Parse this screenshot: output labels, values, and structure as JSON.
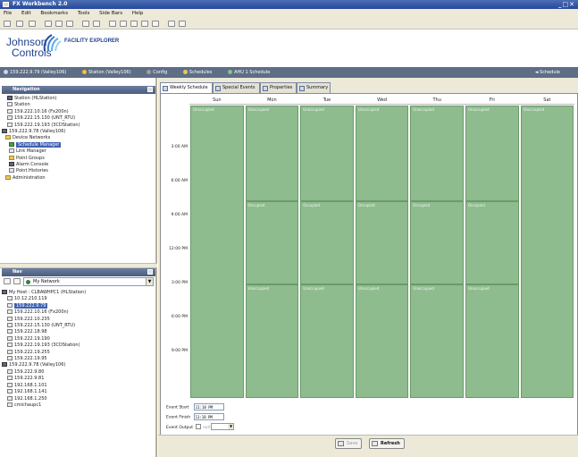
{
  "window": {
    "title": "FX Workbench 2.0"
  },
  "menu": [
    "File",
    "Edit",
    "Bookmarks",
    "Tools",
    "Side Bars",
    "Help"
  ],
  "brand": {
    "company": "Johnson Controls",
    "company_line1": "Johnson",
    "company_line2": "Controls",
    "product": "FACILITY EXPLORER"
  },
  "breadcrumb": {
    "items": [
      "159.222.9.79 (Valley106)",
      "Station (Valley106)",
      "Config",
      "Schedules",
      "AHU 1 Schedule"
    ],
    "right": "Schedule"
  },
  "nav": {
    "title": "Navigation",
    "items": [
      "Station (HLStation)",
      "Station",
      "159.222.10.16 (Fx200n)",
      "159.222.15.130 (UNT_RTU)",
      "159.222.19.193 (3CDStation)",
      "159.222.9.78 (Valley106)",
      "Device Networks",
      "Schedule Manager",
      "Link Manager",
      "Point Groups",
      "Alarm Console",
      "Point Histories",
      "Administration"
    ],
    "selected_index": 7
  },
  "palette": {
    "title": "Nav",
    "combo": "My Network",
    "items": [
      "My Host : CLBAWHPC1 (HLStation)",
      "10.12.210.119",
      "159.222.9.79",
      "159.222.10.16 (Fx200n)",
      "159.222.10.235",
      "159.222.15.130 (UNT_RTU)",
      "159.222.18.98",
      "159.222.19.190",
      "159.222.19.193 (3CDStation)",
      "159.222.19.255",
      "159.222.19.95",
      "159.222.9.78 (Valley106)",
      "159.222.9.80",
      "159.222.9.81",
      "192.168.1.101",
      "192.168.1.141",
      "192.168.1.250",
      "cmichaupc1"
    ],
    "selected_index": 2
  },
  "tabs": [
    "Weekly Schedule",
    "Special Events",
    "Properties",
    "Summary"
  ],
  "schedule": {
    "days": [
      "Sun",
      "Mon",
      "Tue",
      "Wed",
      "Thu",
      "Fri",
      "Sat"
    ],
    "times": [
      "3:00 AM",
      "6:00 AM",
      "9:00 AM",
      "12:00 PM",
      "3:00 PM",
      "6:00 PM",
      "9:00 PM"
    ],
    "block_label_unoccupied": "Unoccupied",
    "block_label_occupied": "Occupied",
    "event_start_label": "Event Start",
    "event_start_value": "11:18 PM",
    "event_finish_label": "Event Finish",
    "event_finish_value": "11:18 PM",
    "event_output_label": "Event Output",
    "event_output_null": "null"
  },
  "footer": {
    "save_label": "Save",
    "refresh_label": "Refresh"
  },
  "colors": {
    "block": "#8fbc8f",
    "header": "#5e6e86",
    "accent": "#3f62b0"
  }
}
